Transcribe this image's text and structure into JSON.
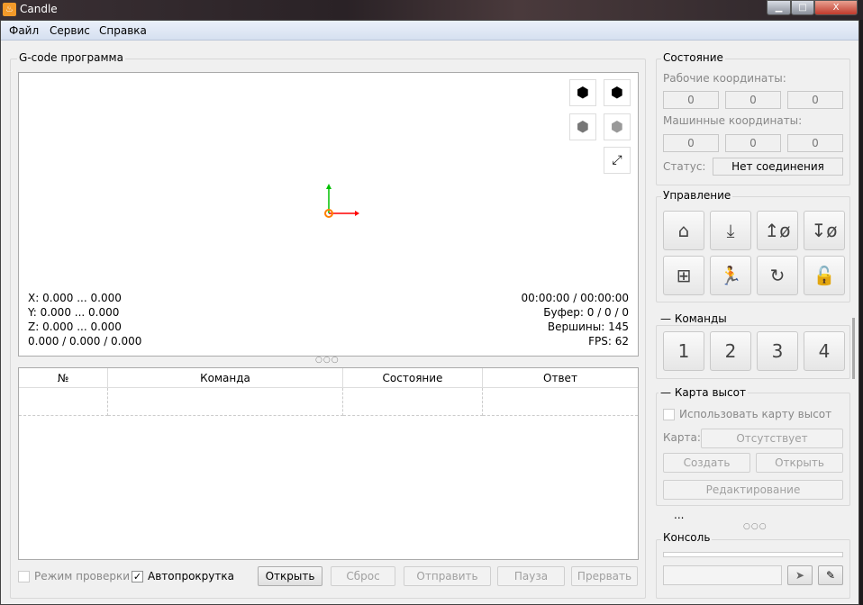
{
  "window": {
    "title": "Candle",
    "minimize": "▁",
    "maximize": "□",
    "close": "X"
  },
  "menu": [
    "Файл",
    "Сервис",
    "Справка"
  ],
  "gcode": {
    "title": "G-code программа",
    "view_buttons": [
      "view-isometric-icon",
      "view-top-icon",
      "view-front-icon",
      "view-left-icon",
      "fit-icon"
    ],
    "overlay_left": [
      "X: 0.000 ... 0.000",
      "Y: 0.000 ... 0.000",
      "Z: 0.000 ... 0.000",
      "0.000 / 0.000 / 0.000"
    ],
    "overlay_right": [
      "00:00:00 / 00:00:00",
      "Буфер: 0 / 0 / 0",
      "Вершины: 145",
      "FPS: 62"
    ],
    "table_headers": [
      "№",
      "Команда",
      "Состояние",
      "Ответ"
    ],
    "check_mode": "Режим проверки",
    "check_mode_checked": false,
    "autoscroll": "Автопрокрутка",
    "autoscroll_checked": true,
    "buttons": {
      "open": "Открыть",
      "reset": "Сброс",
      "send": "Отправить",
      "pause": "Пауза",
      "abort": "Прервать"
    }
  },
  "state": {
    "title": "Состояние",
    "work_label": "Рабочие координаты:",
    "work": [
      "0",
      "0",
      "0"
    ],
    "machine_label": "Машинные координаты:",
    "machine": [
      "0",
      "0",
      "0"
    ],
    "status_label": "Статус:",
    "status": "Нет соединения"
  },
  "control": {
    "title": "Управление",
    "buttons": [
      "home-icon",
      "probe-z-icon",
      "zero-xy-icon",
      "zero-z-icon",
      "restore-origin-icon",
      "safe-position-icon",
      "reset-icon",
      "unlock-icon"
    ]
  },
  "commands": {
    "title": "Команды",
    "buttons": [
      "1",
      "2",
      "3",
      "4"
    ]
  },
  "heightmap": {
    "title": "Карта высот",
    "use": "Использовать карту высот",
    "map_label": "Карта:",
    "map_value": "Отсутствует",
    "create": "Создать",
    "open": "Открыть",
    "edit": "Редактирование",
    "more": "..."
  },
  "console": {
    "title": "Консоль",
    "input": ""
  },
  "colors": {
    "x_axis": "#ff0000",
    "y_axis": "#00c000",
    "origin": "#ff7f00"
  }
}
